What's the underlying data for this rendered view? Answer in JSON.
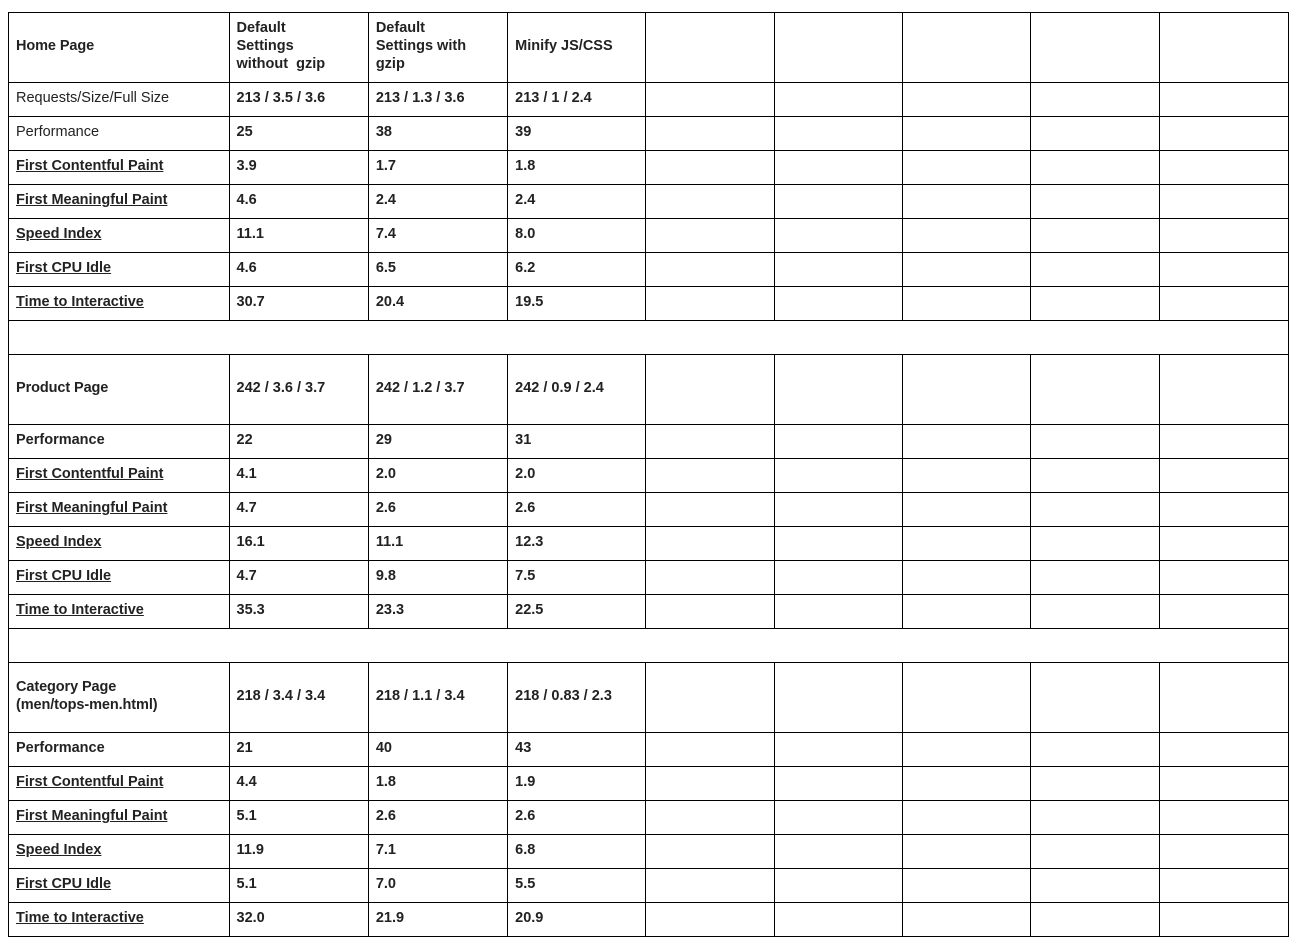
{
  "table": {
    "columns": [
      {
        "key": "label",
        "header": ""
      },
      {
        "key": "col1",
        "header": "Default\nSettings\nwithout  gzip"
      },
      {
        "key": "col2",
        "header": "Default\nSettings with\ngzip"
      },
      {
        "key": "col3",
        "header": "Minify JS/CSS"
      },
      {
        "key": "col4",
        "header": ""
      },
      {
        "key": "col5",
        "header": ""
      },
      {
        "key": "col6",
        "header": ""
      },
      {
        "key": "col7",
        "header": ""
      },
      {
        "key": "col8",
        "header": ""
      }
    ],
    "sections": [
      {
        "id": "home-page",
        "title": "Home Page",
        "title_style": "section-title",
        "header_cells": [
          {
            "text": "Default\nSettings\nwithout  gzip",
            "style": "hdr"
          },
          {
            "text": "Default\nSettings with\ngzip",
            "style": "hdr"
          },
          {
            "text": "Minify JS/CSS",
            "style": "hdr"
          },
          {
            "text": "",
            "style": "blank"
          },
          {
            "text": "",
            "style": "blank"
          },
          {
            "text": "",
            "style": "blank"
          },
          {
            "text": "",
            "style": "blank"
          },
          {
            "text": "",
            "style": "blank"
          }
        ],
        "rows": [
          {
            "label": "Requests/Size/Full Size",
            "label_style": "label-plain",
            "link": false,
            "values": [
              {
                "text": "213 / 3.5 / 3.6",
                "color": "black",
                "style": "val-bold"
              },
              {
                "text": "213 / 1.3 / 3.6",
                "color": "black",
                "style": "val-bold"
              },
              {
                "text": "213 / 1 / 2.4",
                "color": "black",
                "style": "val-bold"
              }
            ]
          },
          {
            "label": "Performance",
            "label_style": "label-plain",
            "link": false,
            "values": [
              {
                "text": "25",
                "color": "black",
                "style": "val-bold"
              },
              {
                "text": "38",
                "color": "black",
                "style": "val-bold"
              },
              {
                "text": "39",
                "color": "black",
                "style": "val-bold"
              }
            ]
          },
          {
            "label": "First Contentful Paint",
            "label_style": "metric-link",
            "link": true,
            "values": [
              {
                "text": "3.9",
                "color": "orange",
                "style": "val-num"
              },
              {
                "text": "1.7",
                "color": "green",
                "style": "val-num"
              },
              {
                "text": "1.8",
                "color": "green",
                "style": "val-num"
              }
            ]
          },
          {
            "label": "First Meaningful Paint",
            "label_style": "metric-link",
            "link": true,
            "values": [
              {
                "text": "4.6",
                "color": "red",
                "style": "val-num"
              },
              {
                "text": "2.4",
                "color": "orange",
                "style": "val-num"
              },
              {
                "text": "2.4",
                "color": "orange",
                "style": "val-num"
              }
            ]
          },
          {
            "label": "Speed Index",
            "label_style": "metric-link",
            "link": true,
            "values": [
              {
                "text": "11.1",
                "color": "red",
                "style": "val-num"
              },
              {
                "text": "7.4",
                "color": "red",
                "style": "val-num"
              },
              {
                "text": "8.0",
                "color": "red",
                "style": "val-num"
              }
            ]
          },
          {
            "label": "First CPU Idle",
            "label_style": "metric-link",
            "link": true,
            "values": [
              {
                "text": "4.6",
                "color": "orange",
                "style": "val-num"
              },
              {
                "text": "6.5",
                "color": "orange",
                "style": "val-num"
              },
              {
                "text": "6.2",
                "color": "orange",
                "style": "val-num"
              }
            ]
          },
          {
            "label": "Time to Interactive",
            "label_style": "metric-link",
            "link": true,
            "values": [
              {
                "text": "30.7",
                "color": "red",
                "style": "val-num"
              },
              {
                "text": "20.4",
                "color": "red",
                "style": "val-num"
              },
              {
                "text": "19.5",
                "color": "red",
                "style": "val-num"
              }
            ]
          }
        ]
      },
      {
        "id": "product-page",
        "title": "Product Page",
        "title_style": "section-title",
        "header_cells": [
          {
            "text": "242 / 3.6 / 3.7",
            "style": "val-bold"
          },
          {
            "text": "242 / 1.2 / 3.7",
            "style": "val-bold"
          },
          {
            "text": "242 / 0.9 / 2.4",
            "style": "val-bold"
          },
          {
            "text": "",
            "style": "blank"
          },
          {
            "text": "",
            "style": "blank"
          },
          {
            "text": "",
            "style": "blank"
          },
          {
            "text": "",
            "style": "blank"
          },
          {
            "text": "",
            "style": "blank"
          }
        ],
        "rows": [
          {
            "label": "Performance",
            "label_style": "label-strong",
            "link": false,
            "values": [
              {
                "text": "22",
                "color": "black",
                "style": "val-bold"
              },
              {
                "text": "29",
                "color": "black",
                "style": "val-bold"
              },
              {
                "text": "31",
                "color": "black",
                "style": "val-bold"
              }
            ]
          },
          {
            "label": "First Contentful Paint",
            "label_style": "metric-link",
            "link": true,
            "values": [
              {
                "text": "4.1",
                "color": "red",
                "style": "val-num"
              },
              {
                "text": "2.0",
                "color": "green",
                "style": "val-num"
              },
              {
                "text": "2.0",
                "color": "green",
                "style": "val-num"
              }
            ]
          },
          {
            "label": "First Meaningful Paint",
            "label_style": "metric-link",
            "link": true,
            "values": [
              {
                "text": "4.7",
                "color": "red",
                "style": "val-num"
              },
              {
                "text": "2.6",
                "color": "orange",
                "style": "val-num"
              },
              {
                "text": "2.6",
                "color": "orange",
                "style": "val-num"
              }
            ]
          },
          {
            "label": "Speed Index",
            "label_style": "metric-link",
            "link": true,
            "values": [
              {
                "text": "16.1",
                "color": "red",
                "style": "val-num"
              },
              {
                "text": "11.1",
                "color": "red",
                "style": "val-num"
              },
              {
                "text": "12.3",
                "color": "red",
                "style": "val-num"
              }
            ]
          },
          {
            "label": "First CPU Idle",
            "label_style": "metric-link",
            "link": true,
            "values": [
              {
                "text": "4.7",
                "color": "orange",
                "style": "val-num"
              },
              {
                "text": "9.8",
                "color": "red",
                "style": "val-num"
              },
              {
                "text": "7.5",
                "color": "red",
                "style": "val-num"
              }
            ]
          },
          {
            "label": "Time to Interactive",
            "label_style": "metric-link",
            "link": true,
            "values": [
              {
                "text": "35.3",
                "color": "red",
                "style": "val-num"
              },
              {
                "text": "23.3",
                "color": "red",
                "style": "val-num"
              },
              {
                "text": "22.5",
                "color": "red",
                "style": "val-num"
              }
            ]
          }
        ]
      },
      {
        "id": "category-page",
        "title": "Category Page\n(men/tops-men.html)",
        "title_style": "section-title",
        "header_cells": [
          {
            "text": "218 / 3.4 / 3.4",
            "style": "val-bold"
          },
          {
            "text": "218 / 1.1 / 3.4",
            "style": "val-bold"
          },
          {
            "text": "218 / 0.83 / 2.3",
            "style": "val-bold"
          },
          {
            "text": "",
            "style": "blank"
          },
          {
            "text": "",
            "style": "blank"
          },
          {
            "text": "",
            "style": "blank"
          },
          {
            "text": "",
            "style": "blank"
          },
          {
            "text": "",
            "style": "blank"
          }
        ],
        "rows": [
          {
            "label": "Performance",
            "label_style": "label-strong",
            "link": false,
            "values": [
              {
                "text": "21",
                "color": "black",
                "style": "val-bold"
              },
              {
                "text": "40",
                "color": "green",
                "style": "val-num"
              },
              {
                "text": "43",
                "color": "black",
                "style": "val-bold"
              }
            ]
          },
          {
            "label": "First Contentful Paint",
            "label_style": "metric-link",
            "link": true,
            "values": [
              {
                "text": "4.4",
                "color": "red",
                "style": "val-num"
              },
              {
                "text": "1.8",
                "color": "green",
                "style": "val-num"
              },
              {
                "text": "1.9",
                "color": "green",
                "style": "val-num"
              }
            ]
          },
          {
            "label": "First Meaningful Paint",
            "label_style": "metric-link",
            "link": true,
            "values": [
              {
                "text": "5.1",
                "color": "red",
                "style": "val-num"
              },
              {
                "text": "2.6",
                "color": "orange",
                "style": "val-num"
              },
              {
                "text": "2.6",
                "color": "orange",
                "style": "val-num"
              }
            ]
          },
          {
            "label": "Speed Index",
            "label_style": "metric-link",
            "link": true,
            "values": [
              {
                "text": "11.9",
                "color": "red",
                "style": "val-num"
              },
              {
                "text": "7.1",
                "color": "red",
                "style": "val-num"
              },
              {
                "text": "6.8",
                "color": "red",
                "style": "val-num"
              }
            ]
          },
          {
            "label": "First CPU Idle",
            "label_style": "metric-link",
            "link": true,
            "values": [
              {
                "text": "5.1",
                "color": "orange",
                "style": "val-num"
              },
              {
                "text": "7.0",
                "color": "red",
                "style": "val-num"
              },
              {
                "text": "5.5",
                "color": "orange",
                "style": "val-num"
              }
            ]
          },
          {
            "label": "Time to Interactive",
            "label_style": "metric-link",
            "link": true,
            "values": [
              {
                "text": "32.0",
                "color": "red",
                "style": "val-num"
              },
              {
                "text": "21.9",
                "color": "red",
                "style": "val-num"
              },
              {
                "text": "20.9",
                "color": "red",
                "style": "val-num"
              }
            ]
          }
        ]
      }
    ],
    "empty_column_count": 5
  },
  "colors": {
    "link": "#1155cc",
    "red": "#a61c1c",
    "orange": "#e07b15",
    "green": "#16793a",
    "black": "#1a1a1a",
    "label_gray": "#434343",
    "border": "#000000",
    "background": "#ffffff"
  }
}
